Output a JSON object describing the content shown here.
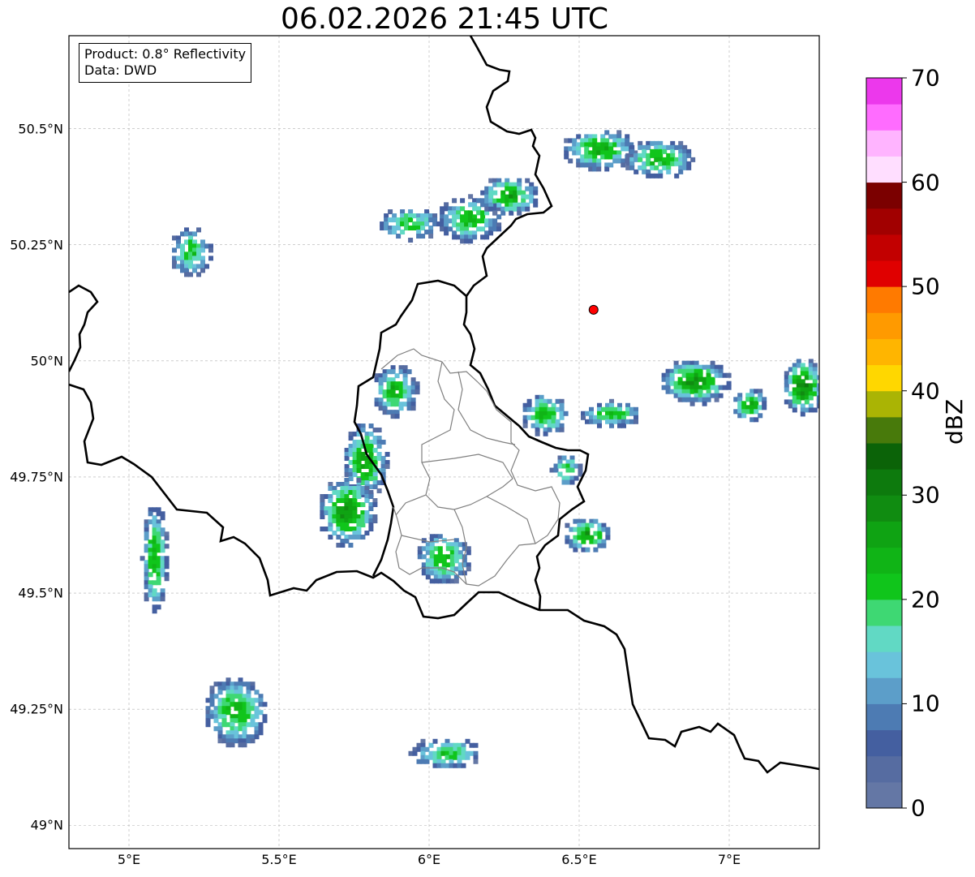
{
  "title": "06.02.2026 21:45 UTC",
  "info": {
    "product": "Product: 0.8° Reflectivity",
    "source": "Data: DWD"
  },
  "map": {
    "extent": {
      "lon_min": 4.8,
      "lon_max": 7.3,
      "lat_min": 48.95,
      "lat_max": 50.7
    },
    "lat_ticks": [
      {
        "value": 50.5,
        "label": "50.5°N"
      },
      {
        "value": 50.25,
        "label": "50.25°N"
      },
      {
        "value": 50.0,
        "label": "50°N"
      },
      {
        "value": 49.75,
        "label": "49.75°N"
      },
      {
        "value": 49.5,
        "label": "49.5°N"
      },
      {
        "value": 49.25,
        "label": "49.25°N"
      },
      {
        "value": 49.0,
        "label": "49°N"
      }
    ],
    "lon_ticks": [
      {
        "value": 5.0,
        "label": "5°E"
      },
      {
        "value": 5.5,
        "label": "5.5°E"
      },
      {
        "value": 6.0,
        "label": "6°E"
      },
      {
        "value": 6.5,
        "label": "6.5°E"
      },
      {
        "value": 7.0,
        "label": "7°E"
      }
    ],
    "gridlines": true,
    "radar_site": {
      "lon": 6.548,
      "lat": 50.11,
      "color": "#ff0000"
    }
  },
  "colorbar": {
    "label": "dBZ",
    "min": 0,
    "max": 70,
    "ticks": [
      "0",
      "10",
      "20",
      "30",
      "40",
      "50",
      "60",
      "70"
    ],
    "colors": [
      "#6477a5",
      "#566ca1",
      "#445fa0",
      "#4d7bb3",
      "#5c9ec9",
      "#69c3db",
      "#61d9c4",
      "#3ed873",
      "#10c51b",
      "#10b416",
      "#0fa313",
      "#108c11",
      "#0d7a0d",
      "#0b6308",
      "#487a0b",
      "#aab404",
      "#ffd700",
      "#ffb500",
      "#ff9a00",
      "#ff7a00",
      "#e00000",
      "#c20000",
      "#a10000",
      "#7b0000",
      "#ffdeff",
      "#ffb4ff",
      "#ff6cff",
      "#ec38ec"
    ]
  },
  "chart_data": {
    "type": "heatmap",
    "title": "06.02.2026 21:45 UTC",
    "xlabel": "",
    "ylabel": "",
    "value_label": "dBZ",
    "value_range": [
      0,
      70
    ],
    "x_range": [
      4.8,
      7.3
    ],
    "y_range": [
      48.95,
      50.7
    ],
    "echoes": [
      {
        "lon": 5.2,
        "lat": 50.24,
        "peak_dbz": 22
      },
      {
        "lon": 6.13,
        "lat": 50.31,
        "peak_dbz": 24
      },
      {
        "lon": 6.26,
        "lat": 50.36,
        "peak_dbz": 26
      },
      {
        "lon": 6.56,
        "lat": 50.46,
        "peak_dbz": 25
      },
      {
        "lon": 6.76,
        "lat": 50.44,
        "peak_dbz": 24
      },
      {
        "lon": 5.93,
        "lat": 50.3,
        "peak_dbz": 22
      },
      {
        "lon": 5.88,
        "lat": 49.94,
        "peak_dbz": 24
      },
      {
        "lon": 5.78,
        "lat": 49.79,
        "peak_dbz": 26
      },
      {
        "lon": 5.72,
        "lat": 49.68,
        "peak_dbz": 28
      },
      {
        "lon": 6.04,
        "lat": 49.58,
        "peak_dbz": 24
      },
      {
        "lon": 6.52,
        "lat": 49.63,
        "peak_dbz": 26
      },
      {
        "lon": 6.38,
        "lat": 49.89,
        "peak_dbz": 24
      },
      {
        "lon": 6.88,
        "lat": 49.96,
        "peak_dbz": 28
      },
      {
        "lon": 7.06,
        "lat": 49.91,
        "peak_dbz": 25
      },
      {
        "lon": 7.24,
        "lat": 49.95,
        "peak_dbz": 30
      },
      {
        "lon": 6.6,
        "lat": 49.89,
        "peak_dbz": 22
      },
      {
        "lon": 5.35,
        "lat": 49.25,
        "peak_dbz": 24
      },
      {
        "lon": 6.05,
        "lat": 49.16,
        "peak_dbz": 22
      },
      {
        "lon": 5.08,
        "lat": 49.58,
        "peak_dbz": 24
      },
      {
        "lon": 6.45,
        "lat": 49.77,
        "peak_dbz": 22
      }
    ]
  }
}
